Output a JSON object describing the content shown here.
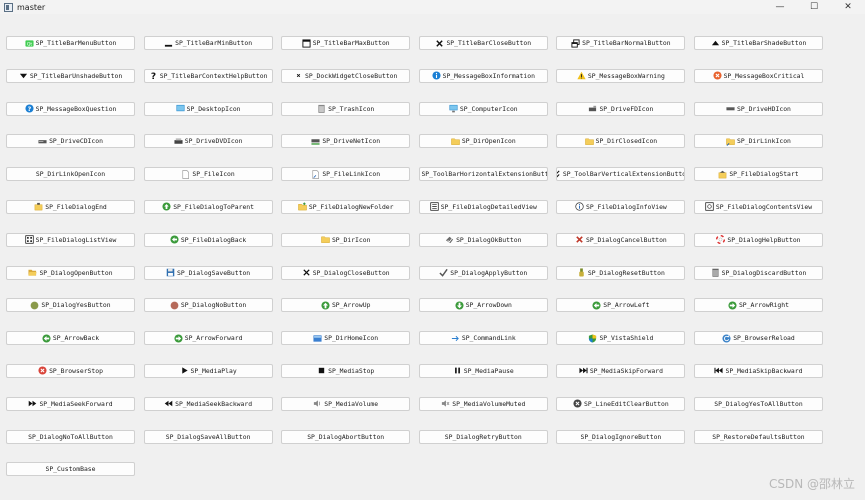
{
  "window": {
    "title": "master",
    "controls": {
      "minimize": "—",
      "maximize": "☐",
      "close": "✕"
    }
  },
  "buttons": [
    {
      "label": "SP_TitleBarMenuButton",
      "icon": "qt-logo"
    },
    {
      "label": "SP_TitleBarMinButton",
      "icon": "min"
    },
    {
      "label": "SP_TitleBarMaxButton",
      "icon": "max"
    },
    {
      "label": "SP_TitleBarCloseButton",
      "icon": "close"
    },
    {
      "label": "SP_TitleBarNormalButton",
      "icon": "normal"
    },
    {
      "label": "SP_TitleBarShadeButton",
      "icon": "shade"
    },
    {
      "label": "SP_TitleBarUnshadeButton",
      "icon": "unshade"
    },
    {
      "label": "SP_TitleBarContextHelpButton",
      "icon": "help-q"
    },
    {
      "label": "SP_DockWidgetCloseButton",
      "icon": "small-dot"
    },
    {
      "label": "SP_MessageBoxInformation",
      "icon": "info"
    },
    {
      "label": "SP_MessageBoxWarning",
      "icon": "warning"
    },
    {
      "label": "SP_MessageBoxCritical",
      "icon": "critical"
    },
    {
      "label": "SP_MessageBoxQuestion",
      "icon": "question"
    },
    {
      "label": "SP_DesktopIcon",
      "icon": "desktop"
    },
    {
      "label": "SP_TrashIcon",
      "icon": "trash"
    },
    {
      "label": "SP_ComputerIcon",
      "icon": "computer"
    },
    {
      "label": "SP_DriveFDIcon",
      "icon": "drive-fd"
    },
    {
      "label": "SP_DriveHDIcon",
      "icon": "drive-hd"
    },
    {
      "label": "SP_DriveCDIcon",
      "icon": "drive-cd"
    },
    {
      "label": "SP_DriveDVDIcon",
      "icon": "drive-dvd"
    },
    {
      "label": "SP_DriveNetIcon",
      "icon": "drive-net"
    },
    {
      "label": "SP_DirOpenIcon",
      "icon": "folder"
    },
    {
      "label": "SP_DirClosedIcon",
      "icon": "folder"
    },
    {
      "label": "SP_DirLinkIcon",
      "icon": "folder-link"
    },
    {
      "label": "SP_DirLinkOpenIcon",
      "icon": ""
    },
    {
      "label": "SP_FileIcon",
      "icon": "file"
    },
    {
      "label": "SP_FileLinkIcon",
      "icon": "file-link"
    },
    {
      "label": "SP_ToolBarHorizontalExtensionButton",
      "icon": "chevrons-right"
    },
    {
      "label": "SP_ToolBarVerticalExtensionButton",
      "icon": "chevrons-down"
    },
    {
      "label": "SP_FileDialogStart",
      "icon": "dialog-start"
    },
    {
      "label": "SP_FileDialogEnd",
      "icon": "dialog-end"
    },
    {
      "label": "SP_FileDialogToParent",
      "icon": "to-parent"
    },
    {
      "label": "SP_FileDialogNewFolder",
      "icon": "new-folder"
    },
    {
      "label": "SP_FileDialogDetailedView",
      "icon": "detailed-view"
    },
    {
      "label": "SP_FileDialogInfoView",
      "icon": "info-view"
    },
    {
      "label": "SP_FileDialogContentsView",
      "icon": "contents-view"
    },
    {
      "label": "SP_FileDialogListView",
      "icon": "list-view"
    },
    {
      "label": "SP_FileDialogBack",
      "icon": "back"
    },
    {
      "label": "SP_DirIcon",
      "icon": "folder"
    },
    {
      "label": "SP_DialogOkButton",
      "icon": "ok"
    },
    {
      "label": "SP_DialogCancelButton",
      "icon": "cancel"
    },
    {
      "label": "SP_DialogHelpButton",
      "icon": "lifebuoy"
    },
    {
      "label": "SP_DialogOpenButton",
      "icon": "open-folder"
    },
    {
      "label": "SP_DialogSaveButton",
      "icon": "save"
    },
    {
      "label": "SP_DialogCloseButton",
      "icon": "dialog-close"
    },
    {
      "label": "SP_DialogApplyButton",
      "icon": "apply"
    },
    {
      "label": "SP_DialogResetButton",
      "icon": "reset"
    },
    {
      "label": "SP_DialogDiscardButton",
      "icon": "discard"
    },
    {
      "label": "SP_DialogYesButton",
      "icon": "yes"
    },
    {
      "label": "SP_DialogNoButton",
      "icon": "no"
    },
    {
      "label": "SP_ArrowUp",
      "icon": "arrow-up"
    },
    {
      "label": "SP_ArrowDown",
      "icon": "arrow-down"
    },
    {
      "label": "SP_ArrowLeft",
      "icon": "arrow-left"
    },
    {
      "label": "SP_ArrowRight",
      "icon": "arrow-right"
    },
    {
      "label": "SP_ArrowBack",
      "icon": "arrow-back"
    },
    {
      "label": "SP_ArrowForward",
      "icon": "arrow-forward"
    },
    {
      "label": "SP_DirHomeIcon",
      "icon": "dir-home"
    },
    {
      "label": "SP_CommandLink",
      "icon": "command-link"
    },
    {
      "label": "SP_VistaShield",
      "icon": "shield"
    },
    {
      "label": "SP_BrowserReload",
      "icon": "reload"
    },
    {
      "label": "SP_BrowserStop",
      "icon": "stop"
    },
    {
      "label": "SP_MediaPlay",
      "icon": "play"
    },
    {
      "label": "SP_MediaStop",
      "icon": "media-stop"
    },
    {
      "label": "SP_MediaPause",
      "icon": "pause"
    },
    {
      "label": "SP_MediaSkipForward",
      "icon": "skip-forward"
    },
    {
      "label": "SP_MediaSkipBackward",
      "icon": "skip-backward"
    },
    {
      "label": "SP_MediaSeekForward",
      "icon": "seek-forward"
    },
    {
      "label": "SP_MediaSeekBackward",
      "icon": "seek-backward"
    },
    {
      "label": "SP_MediaVolume",
      "icon": "volume"
    },
    {
      "label": "SP_MediaVolumeMuted",
      "icon": "volume-muted"
    },
    {
      "label": "SP_LineEditClearButton",
      "icon": "clear"
    },
    {
      "label": "SP_DialogYesToAllButton",
      "icon": ""
    },
    {
      "label": "SP_DialogNoToAllButton",
      "icon": ""
    },
    {
      "label": "SP_DialogSaveAllButton",
      "icon": ""
    },
    {
      "label": "SP_DialogAbortButton",
      "icon": ""
    },
    {
      "label": "SP_DialogRetryButton",
      "icon": ""
    },
    {
      "label": "SP_DialogIgnoreButton",
      "icon": ""
    },
    {
      "label": "SP_RestoreDefaultsButton",
      "icon": ""
    },
    {
      "label": "SP_CustomBase",
      "icon": ""
    }
  ],
  "watermark": "CSDN @邵林立",
  "colors": {
    "window_bg": "#f0f0f0",
    "button_bg": "#fdfdfd",
    "button_border": "#d0d0d0",
    "info_blue": "#1a7fd4",
    "warning_yellow": "#f2c21b",
    "critical_orange": "#e8612c",
    "ok_green": "#3a9a3a",
    "folder_yellow": "#f4cd5a"
  }
}
